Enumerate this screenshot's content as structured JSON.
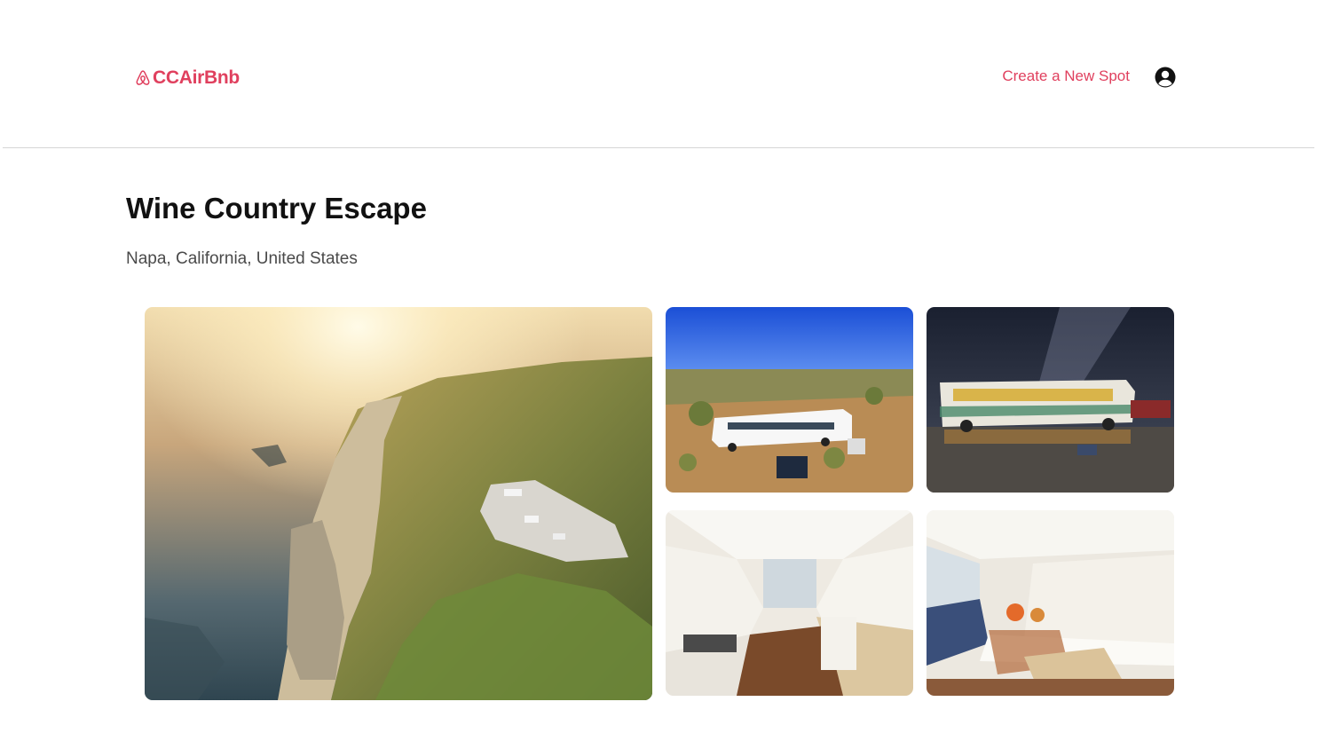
{
  "header": {
    "logo_text": "CCAirBnb",
    "logo_icon": "airbnb-belo-icon",
    "create_spot_label": "Create a New Spot",
    "profile_icon": "user-circle-icon"
  },
  "spot": {
    "title": "Wine Country Escape",
    "location": "Napa, California, United States"
  },
  "gallery": {
    "images": [
      "coastal-cliff-aerial-photo",
      "white-bus-desert-photo",
      "bus-night-sky-photo",
      "bus-kitchen-interior-photo",
      "bus-bedroom-interior-photo"
    ]
  },
  "colors": {
    "brand": "#e0405e",
    "text_primary": "#111111",
    "text_secondary": "#4a4a4a",
    "divider": "#d6d6d6"
  }
}
